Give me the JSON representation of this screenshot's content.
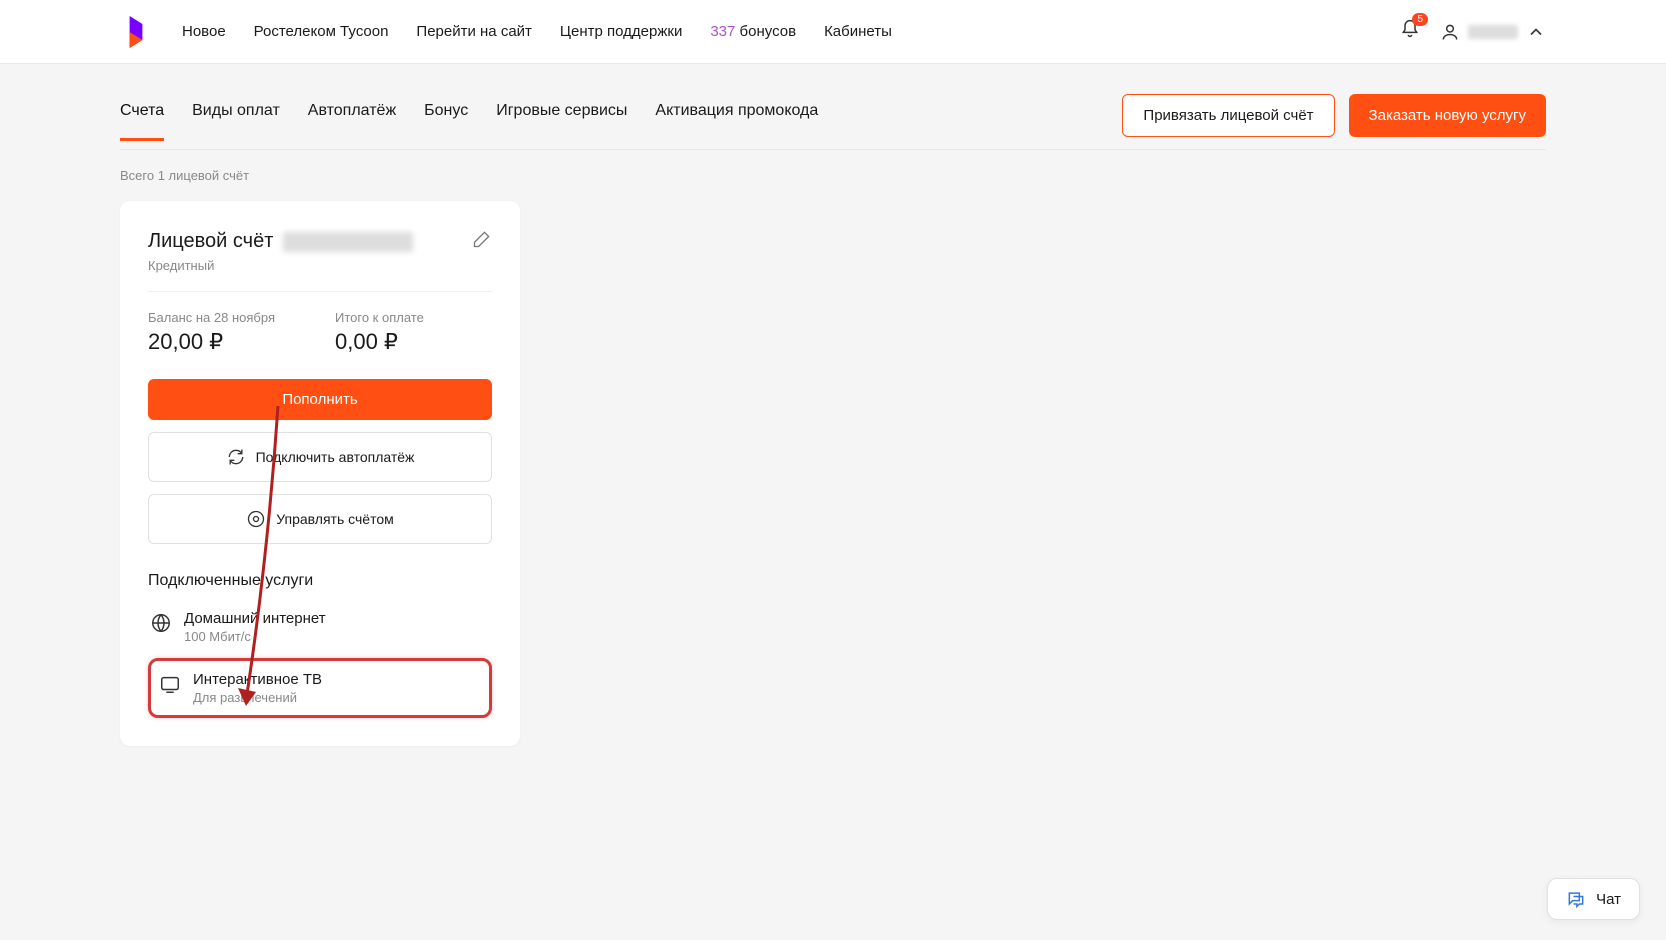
{
  "header": {
    "nav": [
      "Новое",
      "Ростелеком Tycoon",
      "Перейти на сайт",
      "Центр поддержки"
    ],
    "bonus_count": "337",
    "bonus_label": "бонусов",
    "cabinets": "Кабинеты",
    "notification_count": "5"
  },
  "tabs": [
    "Счета",
    "Виды оплат",
    "Автоплатёж",
    "Бонус",
    "Игровые сервисы",
    "Активация промокода"
  ],
  "actions": {
    "link_account": "Привязать лицевой счёт",
    "order_service": "Заказать новую услугу"
  },
  "summary": "Всего 1 лицевой счёт",
  "card": {
    "title": "Лицевой счёт",
    "subtitle": "Кредитный",
    "balance_label": "Баланс на 28 ноября",
    "balance_value": "20,00 ₽",
    "due_label": "Итого к оплате",
    "due_value": "0,00 ₽",
    "topup": "Пополнить",
    "autopay": "Подключить автоплатёж",
    "manage": "Управлять счётом",
    "services_title": "Подключенные услуги",
    "services": [
      {
        "name": "Домашний интернет",
        "desc": "100 Мбит/с"
      },
      {
        "name": "Интерактивное ТВ",
        "desc": "Для развлечений"
      }
    ]
  },
  "chat": "Чат"
}
